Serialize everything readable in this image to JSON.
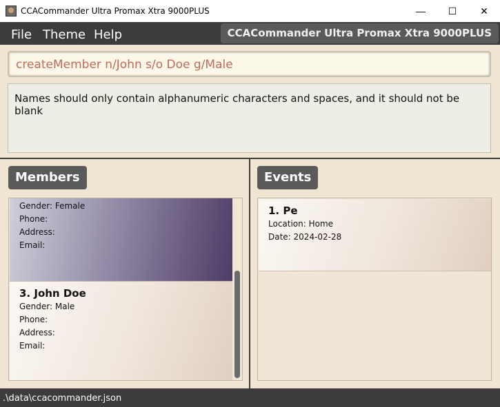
{
  "window": {
    "title": "CCACommander Ultra Promax Xtra 9000PLUS",
    "minimize_glyph": "—",
    "maximize_glyph": "☐",
    "close_glyph": "✕"
  },
  "menu": {
    "items": [
      "File",
      "Theme",
      "Help"
    ],
    "app_name": "CCACommander Ultra Promax Xtra 9000PLUS"
  },
  "command": {
    "value": "createMember n/John s/o Doe g/Male"
  },
  "result": {
    "message": "Names should only contain alphanumeric characters and spaces, and it should not be blank"
  },
  "members": {
    "title": "Members",
    "cards": [
      {
        "title": "",
        "lines": [
          "Gender: Female",
          "Phone:",
          "Address:",
          "Email:"
        ]
      },
      {
        "title": "3.  John Doe",
        "lines": [
          "Gender: Male",
          "Phone:",
          "Address:",
          "Email:"
        ]
      }
    ]
  },
  "events": {
    "title": "Events",
    "cards": [
      {
        "title": "1.  Pe",
        "lines": [
          "Location: Home",
          "Date: 2024-02-28"
        ]
      }
    ]
  },
  "status": {
    "path": ".\\data\\ccacommander.json"
  },
  "colors": {
    "dark": "#3c3c3c",
    "panel_bg": "#f0e4d2",
    "selected_card": "#4e3c66",
    "command_text": "#c06a5a"
  }
}
